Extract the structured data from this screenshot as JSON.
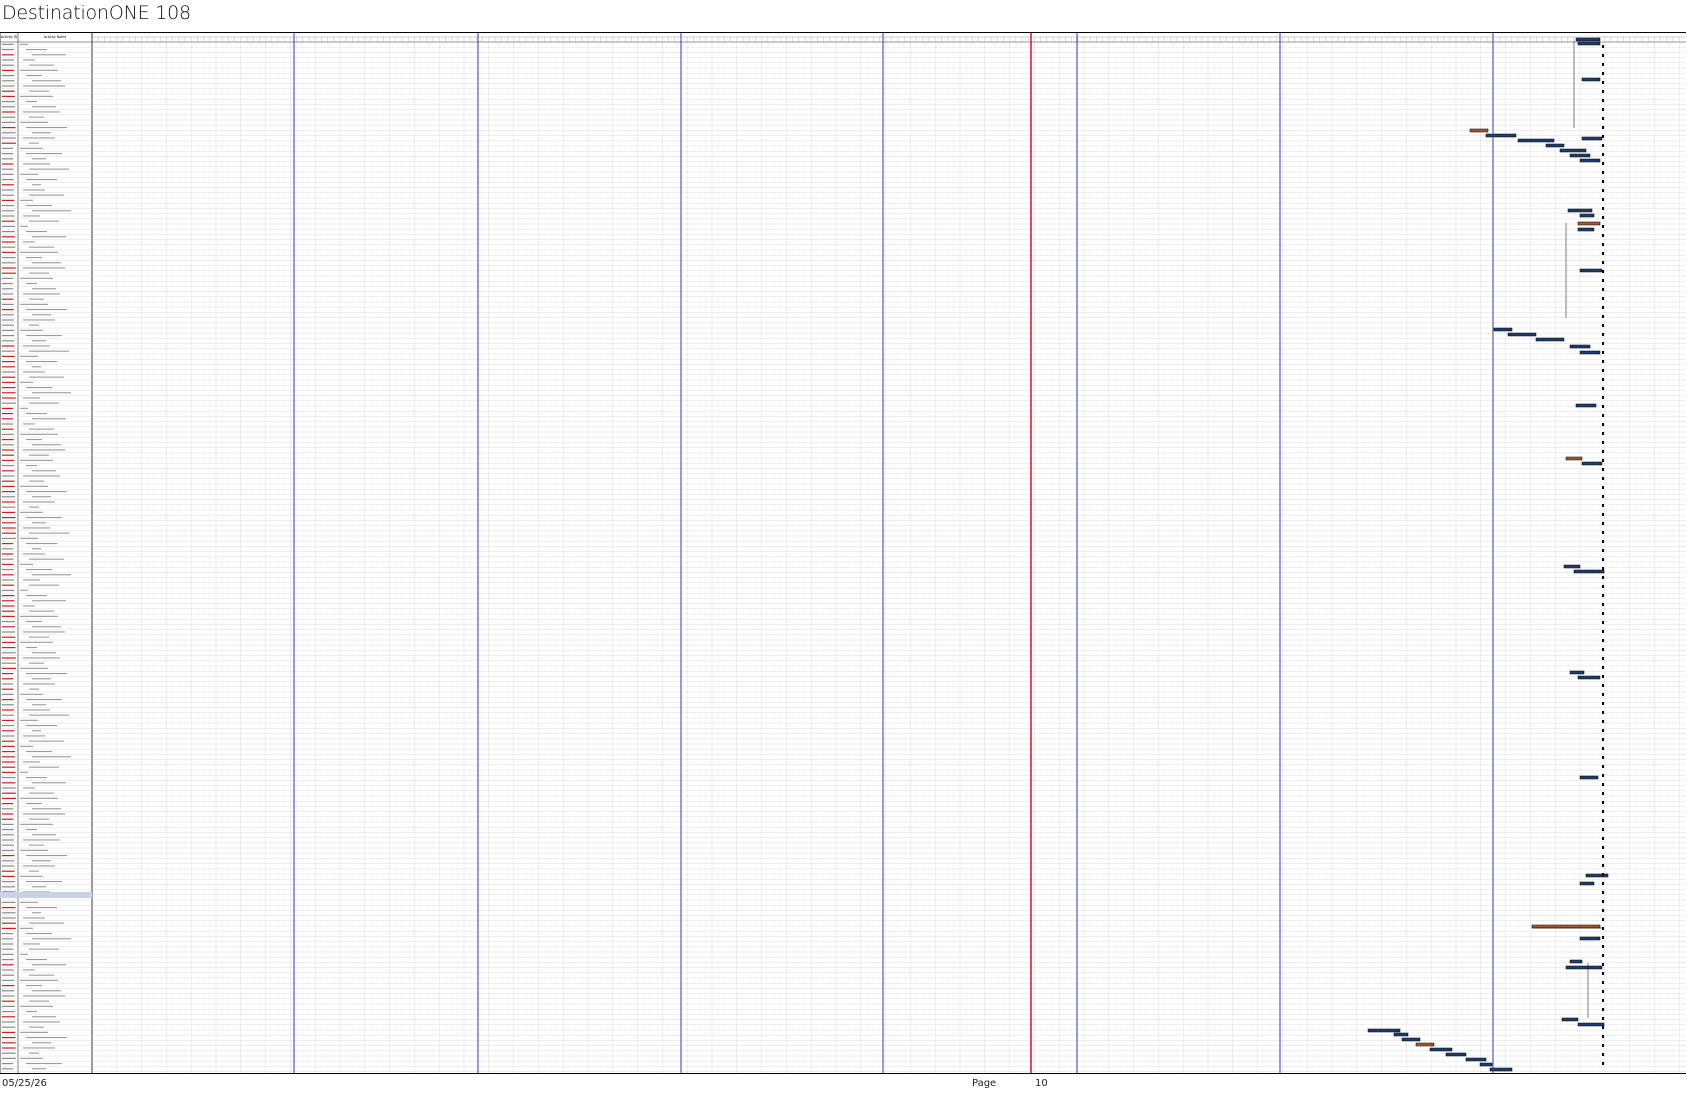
{
  "page": {
    "title": "DestinationONE 108"
  },
  "table": {
    "headers": [
      "Activity ID",
      "Activity Name"
    ]
  },
  "footer": {
    "date": "05/25/26",
    "page_label": "Page",
    "page_number": "10"
  },
  "colors": {
    "grid_major_line": "#2b3fa8",
    "current_date_line": "#d8232a",
    "bar_fill": "#1f3e6a",
    "bar_outline": "#000000",
    "bar_alt_fill": "#a05a2c",
    "summary_fill": "#000000",
    "row_highlight": "#c9d3e8",
    "id_red_text": "#cc1f1f",
    "id_black_text": "#222222"
  }
}
